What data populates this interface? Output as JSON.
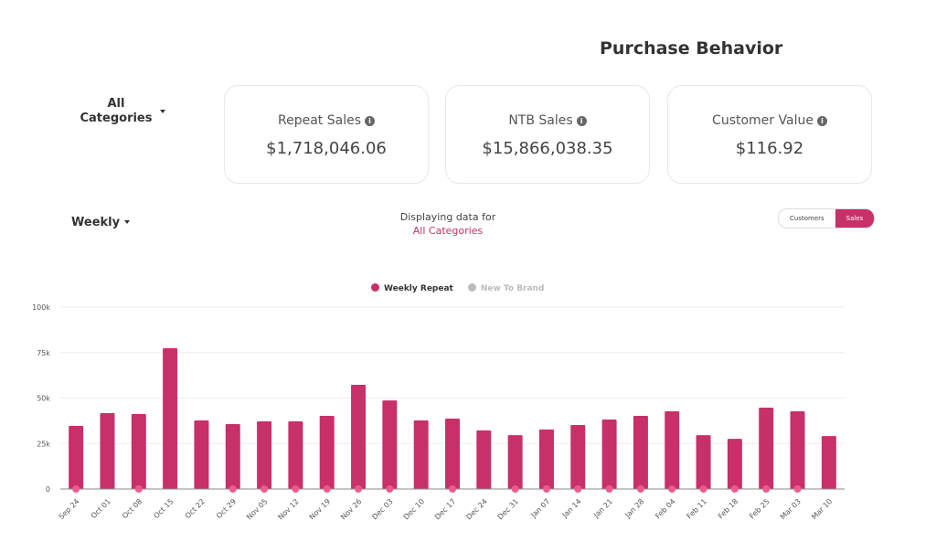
{
  "header": {
    "title": "Purchase Behavior"
  },
  "category_select": {
    "value": "All Categories"
  },
  "cards": [
    {
      "label": "Repeat Sales",
      "value": "$1,718,046.06"
    },
    {
      "label": "NTB Sales",
      "value": "$15,866,038.35"
    },
    {
      "label": "Customer Value",
      "value": "$116.92"
    }
  ],
  "period_select": {
    "value": "Weekly"
  },
  "display_info": {
    "prefix": "Displaying data for",
    "category": "All Categories"
  },
  "toggle": {
    "options": [
      "Customers",
      "Sales"
    ],
    "selected": "Sales"
  },
  "colors": {
    "accent": "#c8306a",
    "dot": "#ef5a8c",
    "inactive": "#bbbbbb"
  },
  "chart_data": {
    "type": "bar",
    "legend": [
      {
        "name": "Weekly Repeat",
        "color": "#c8306a",
        "active": true
      },
      {
        "name": "New To Brand",
        "color": "#bbbbbb",
        "active": false
      }
    ],
    "legend_placement": "top",
    "categories": [
      "Sep 24",
      "Oct 01",
      "Oct 08",
      "Oct 15",
      "Oct 22",
      "Oct 29",
      "Nov 05",
      "Nov 12",
      "Nov 19",
      "Nov 26",
      "Dec 03",
      "Dec 10",
      "Dec 17",
      "Dec 24",
      "Dec 31",
      "Jan 07",
      "Jan 14",
      "Jan 21",
      "Jan 28",
      "Feb 04",
      "Feb 11",
      "Feb 18",
      "Feb 25",
      "Mar 03",
      "Mar 10"
    ],
    "series": [
      {
        "name": "Weekly Repeat",
        "values": [
          34700,
          41700,
          41200,
          77400,
          37700,
          35700,
          37200,
          37200,
          40200,
          57300,
          48700,
          37700,
          38700,
          32200,
          29600,
          32700,
          35200,
          38200,
          40200,
          42700,
          29600,
          27600,
          44700,
          42700,
          29100
        ]
      }
    ],
    "zero_markers": [
      true,
      false,
      true,
      false,
      false,
      true,
      true,
      true,
      true,
      true,
      true,
      false,
      true,
      false,
      true,
      true,
      true,
      true,
      true,
      true,
      true,
      true,
      true,
      true,
      false
    ],
    "yticks": [
      "0",
      "25k",
      "50k",
      "75k",
      "100k"
    ],
    "ylim": [
      0,
      100000
    ],
    "grid": true
  }
}
